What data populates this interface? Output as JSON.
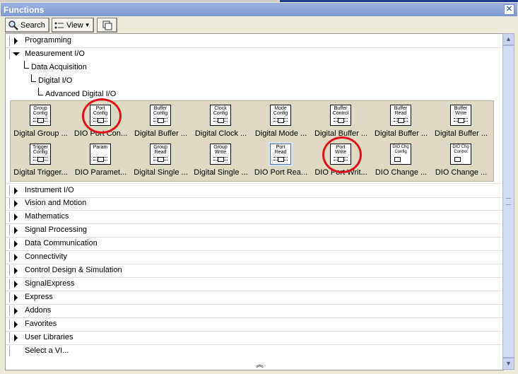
{
  "window": {
    "title": "Functions",
    "close_glyph": "✕"
  },
  "toolbar": {
    "search_label": "Search",
    "view_label": "View"
  },
  "tree_top": [
    {
      "label": "Programming",
      "expanded": false
    },
    {
      "label": "Measurement I/O",
      "expanded": true
    }
  ],
  "subpath": [
    "Data Acquisition",
    "Digital I/O",
    "Advanced Digital I/O"
  ],
  "palette_row1": [
    {
      "icon": "Group Config",
      "label": "Digital Group ..."
    },
    {
      "icon": "Port Config",
      "label": "DIO Port Con..."
    },
    {
      "icon": "Buffer Config",
      "label": "Digital Buffer ..."
    },
    {
      "icon": "Clock Config",
      "label": "Digital Clock ..."
    },
    {
      "icon": "Mode Config",
      "label": "Digital Mode ..."
    },
    {
      "icon": "Buffer Control",
      "label": "Digital Buffer ..."
    },
    {
      "icon": "Buffer Read",
      "label": "Digital Buffer ..."
    },
    {
      "icon": "Buffer Write",
      "label": "Digital Buffer ..."
    }
  ],
  "palette_row2": [
    {
      "icon": "Trigger Config",
      "label": "Digital Trigger..."
    },
    {
      "icon": "Param",
      "label": "DIO Paramet..."
    },
    {
      "icon": "Group Read",
      "label": "Digital Single ..."
    },
    {
      "icon": "Group Write",
      "label": "Digital Single ..."
    },
    {
      "icon": "Port Read",
      "label": "DIO Port Rea..."
    },
    {
      "icon": "Port Write",
      "label": "DIO Port Writ..."
    },
    {
      "icon": "DIO Chg Config",
      "label": "DIO Change ..."
    },
    {
      "icon": "DIO Chg Control",
      "label": "DIO Change ..."
    }
  ],
  "tree_bottom": [
    {
      "label": "Instrument I/O"
    },
    {
      "label": "Vision and Motion"
    },
    {
      "label": "Mathematics"
    },
    {
      "label": "Signal Processing"
    },
    {
      "label": "Data Communication"
    },
    {
      "label": "Connectivity"
    },
    {
      "label": "Control Design & Simulation"
    },
    {
      "label": "SignalExpress"
    },
    {
      "label": "Express"
    },
    {
      "label": "Addons"
    },
    {
      "label": "Favorites"
    },
    {
      "label": "User Libraries"
    }
  ],
  "select_vi": "Select a VI...",
  "scroll": {
    "up": "▲",
    "down": "▼",
    "collapse": "︽"
  },
  "colors": {
    "highlight_circle": "#e0101a",
    "title_bar": "#7e98d2"
  },
  "icons": [
    "search-icon",
    "view-icon",
    "palette-options-icon",
    "close-icon"
  ]
}
